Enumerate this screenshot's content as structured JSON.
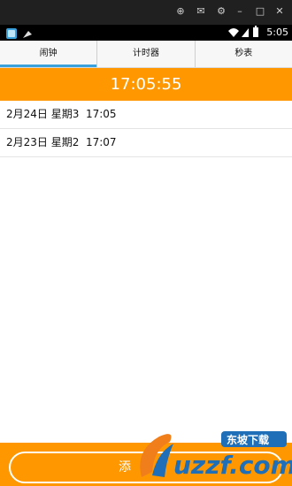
{
  "emulator": {
    "icons": [
      "pin-icon",
      "mail-icon",
      "gear-icon",
      "minimize-icon",
      "maximize-icon",
      "close-icon"
    ]
  },
  "status_bar": {
    "time": "5:05",
    "icons": [
      "app-icon",
      "notification-icon",
      "wifi-icon",
      "signal-icon",
      "battery-icon"
    ]
  },
  "tabs": [
    {
      "label": "闹钟",
      "active": true
    },
    {
      "label": "计时器",
      "active": false
    },
    {
      "label": "秒表",
      "active": false
    }
  ],
  "clock": {
    "time": "17:05:55"
  },
  "alarms": [
    {
      "text": "2月24日 星期3  17:05"
    },
    {
      "text": "2月23日 星期2  17:07"
    }
  ],
  "add_button": {
    "label": "添"
  },
  "watermark": {
    "brand": "uzzf.com",
    "tag": "东坡下载"
  },
  "colors": {
    "accent_orange": "#ff9800",
    "tab_indicator": "#3aa1dc",
    "watermark_blue": "#1f6fb8",
    "watermark_orange": "#f07f1b"
  }
}
